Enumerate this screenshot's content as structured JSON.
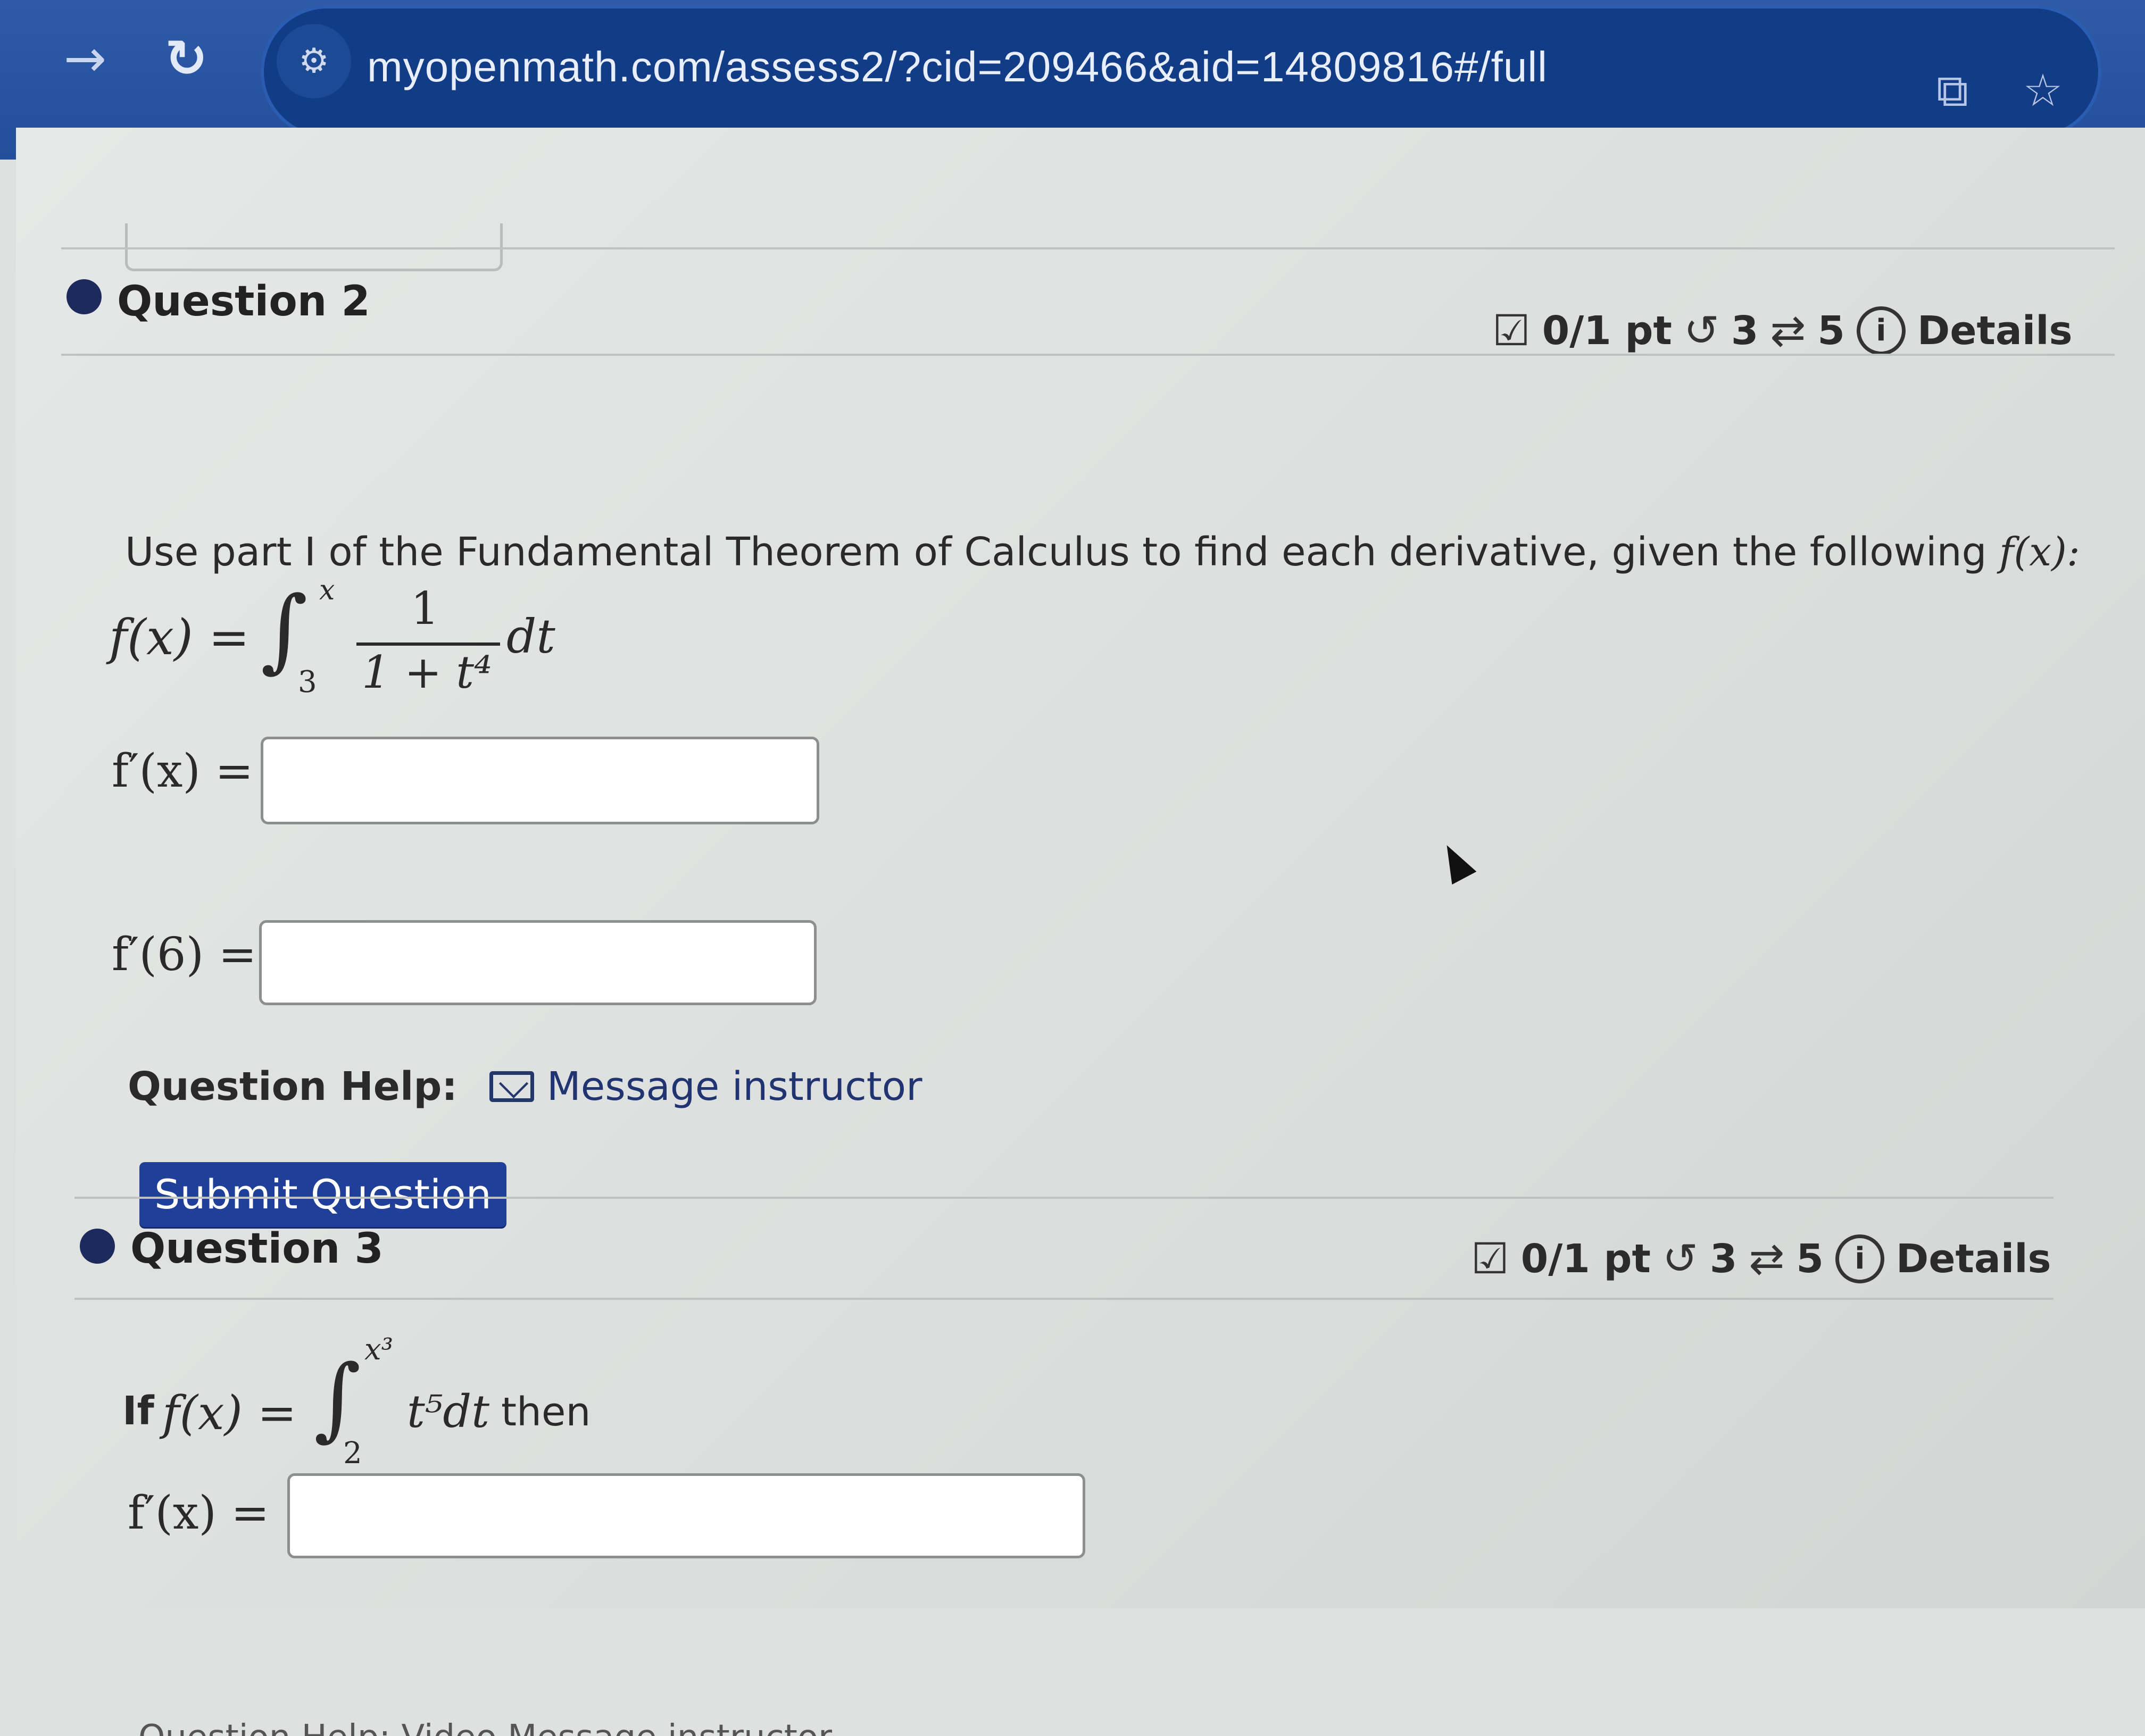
{
  "browser": {
    "url": "myopenmath.com/assess2/?cid=209466&aid=14809816#/full"
  },
  "previous": {
    "submit_label": "Submit Question"
  },
  "question2": {
    "title": "Question 2",
    "score": "0/1 pt",
    "attempts": "3",
    "regens": "5",
    "details": "Details",
    "prompt_text": "Use part I of the Fundamental Theorem of Calculus to find each derivative, given the following ",
    "prompt_fx": "f(x):",
    "formula": {
      "lhs": "f(x) =",
      "upper": "x",
      "lower": "3",
      "numerator": "1",
      "denominator": "1 + t⁴",
      "dt": "dt"
    },
    "answer1_label": "f′(x) =",
    "answer2_label": "f′(6) =",
    "help_label": "Question Help:",
    "help_link": "Message instructor",
    "submit_label": "Submit Question"
  },
  "question3": {
    "title": "Question 3",
    "score": "0/1 pt",
    "attempts": "3",
    "regens": "5",
    "details": "Details",
    "if_text": "If",
    "lhs": "f(x) =",
    "upper": "x³",
    "lower": "2",
    "integrand": "t⁵dt",
    "then_text": "then",
    "answer_label": "f′(x) =",
    "help_fragment": "Question Help:  Video  Message instructor"
  }
}
